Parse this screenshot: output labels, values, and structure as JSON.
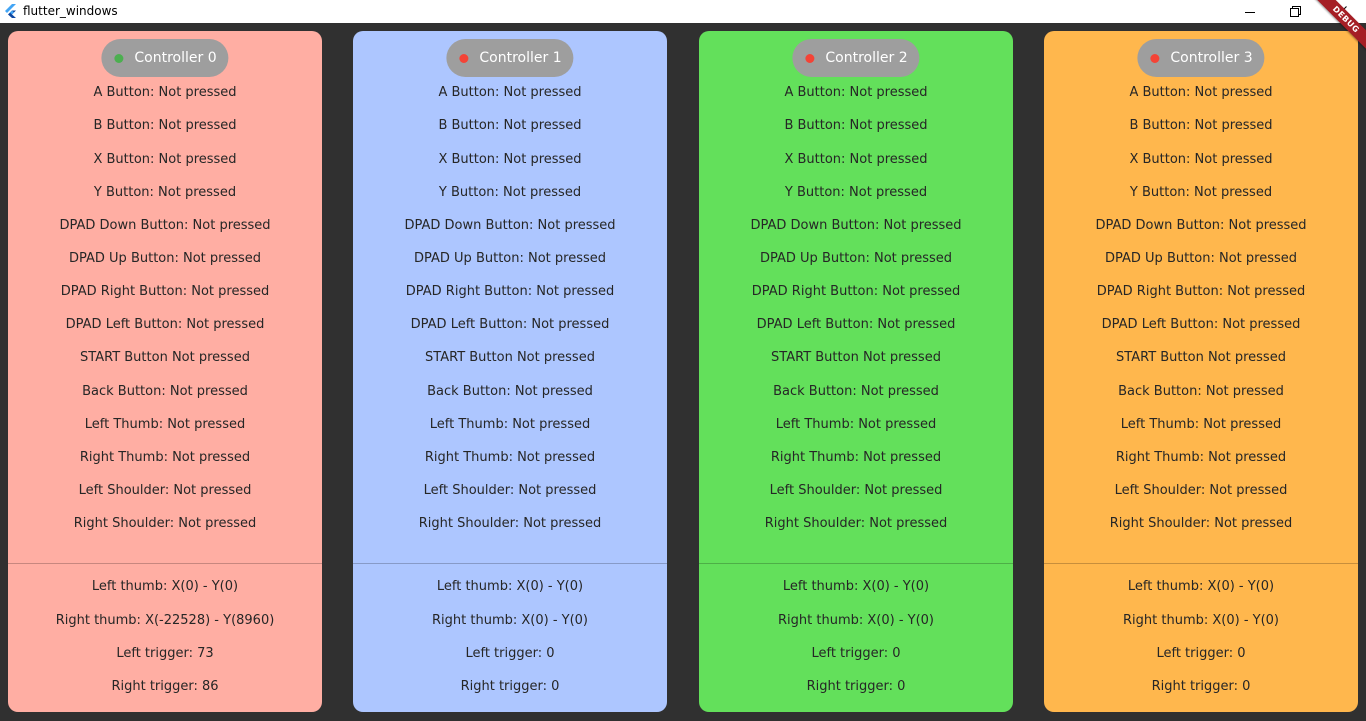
{
  "window": {
    "title": "flutter_windows",
    "minimize_icon": "minimize-icon",
    "maximize_icon": "restore-icon",
    "close_icon": "close-icon"
  },
  "debug_banner": "DEBUG",
  "colors": {
    "background": "#303030",
    "pill": "#9e9e9e",
    "connected": "#4caf50",
    "disconnected": "#f44336",
    "debug": "#a51e25"
  },
  "controllers": [
    {
      "label": "Controller 0",
      "background": "#ffaea3",
      "connected": true,
      "buttons": [
        "A Button: Not pressed",
        "B Button: Not pressed",
        "X Button: Not pressed",
        "Y Button: Not pressed",
        "DPAD Down Button: Not pressed",
        "DPAD Up Button: Not pressed",
        "DPAD Right Button: Not pressed",
        "DPAD Left Button: Not pressed",
        "START Button Not pressed",
        "Back Button: Not pressed",
        "Left Thumb: Not pressed",
        "Right Thumb: Not pressed",
        "Left Shoulder: Not pressed",
        "Right Shoulder: Not pressed"
      ],
      "axes": [
        "Left thumb: X(0) - Y(0)",
        "Right thumb: X(-22528) - Y(8960)",
        "Left trigger: 73",
        "Right trigger: 86"
      ]
    },
    {
      "label": "Controller 1",
      "background": "#adc6ff",
      "connected": false,
      "buttons": [
        "A Button: Not pressed",
        "B Button: Not pressed",
        "X Button: Not pressed",
        "Y Button: Not pressed",
        "DPAD Down Button: Not pressed",
        "DPAD Up Button: Not pressed",
        "DPAD Right Button: Not pressed",
        "DPAD Left Button: Not pressed",
        "START Button Not pressed",
        "Back Button: Not pressed",
        "Left Thumb: Not pressed",
        "Right Thumb: Not pressed",
        "Left Shoulder: Not pressed",
        "Right Shoulder: Not pressed"
      ],
      "axes": [
        "Left thumb: X(0) - Y(0)",
        "Right thumb: X(0) - Y(0)",
        "Left trigger: 0",
        "Right trigger: 0"
      ]
    },
    {
      "label": "Controller 2",
      "background": "#63e05b",
      "connected": false,
      "buttons": [
        "A Button: Not pressed",
        "B Button: Not pressed",
        "X Button: Not pressed",
        "Y Button: Not pressed",
        "DPAD Down Button: Not pressed",
        "DPAD Up Button: Not pressed",
        "DPAD Right Button: Not pressed",
        "DPAD Left Button: Not pressed",
        "START Button Not pressed",
        "Back Button: Not pressed",
        "Left Thumb: Not pressed",
        "Right Thumb: Not pressed",
        "Left Shoulder: Not pressed",
        "Right Shoulder: Not pressed"
      ],
      "axes": [
        "Left thumb: X(0) - Y(0)",
        "Right thumb: X(0) - Y(0)",
        "Left trigger: 0",
        "Right trigger: 0"
      ]
    },
    {
      "label": "Controller 3",
      "background": "#ffb74d",
      "connected": false,
      "buttons": [
        "A Button: Not pressed",
        "B Button: Not pressed",
        "X Button: Not pressed",
        "Y Button: Not pressed",
        "DPAD Down Button: Not pressed",
        "DPAD Up Button: Not pressed",
        "DPAD Right Button: Not pressed",
        "DPAD Left Button: Not pressed",
        "START Button Not pressed",
        "Back Button: Not pressed",
        "Left Thumb: Not pressed",
        "Right Thumb: Not pressed",
        "Left Shoulder: Not pressed",
        "Right Shoulder: Not pressed"
      ],
      "axes": [
        "Left thumb: X(0) - Y(0)",
        "Right thumb: X(0) - Y(0)",
        "Left trigger: 0",
        "Right trigger: 0"
      ]
    }
  ]
}
